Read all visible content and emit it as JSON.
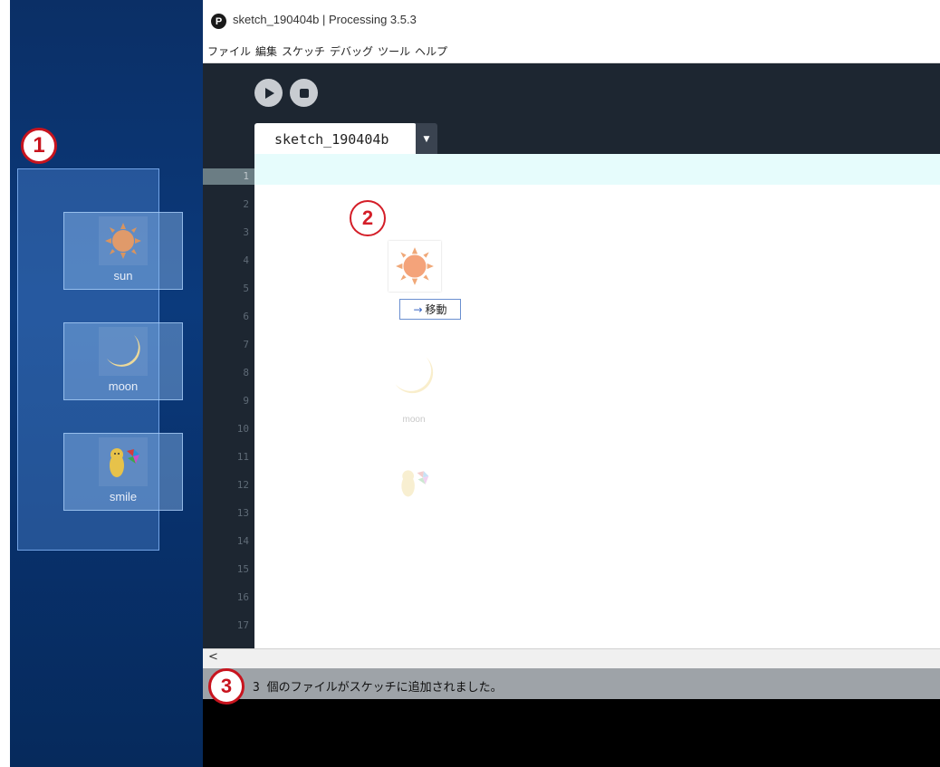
{
  "window": {
    "title": "sketch_190404b | Processing 3.5.3",
    "app_icon_glyph": "P"
  },
  "menu": [
    "ファイル",
    "編集",
    "スケッチ",
    "デバッグ",
    "ツール",
    "ヘルプ"
  ],
  "toolbar": {
    "run_icon": "play-icon",
    "stop_icon": "stop-icon"
  },
  "tab": {
    "label": "sketch_190404b",
    "arrow": "▼"
  },
  "editor": {
    "line_numbers": [
      "1",
      "2",
      "3",
      "4",
      "5",
      "6",
      "7",
      "8",
      "9",
      "10",
      "11",
      "12",
      "13",
      "14",
      "15",
      "16",
      "17"
    ]
  },
  "desktop": {
    "files": [
      {
        "label": "sun",
        "icon": "sun-icon"
      },
      {
        "label": "moon",
        "icon": "moon-icon"
      },
      {
        "label": "smile",
        "icon": "smile-icon"
      }
    ]
  },
  "drag": {
    "tooltip": "移動",
    "tooltip_arrow": "→",
    "moon_label": "moon"
  },
  "scroll": {
    "left_arrow": "<"
  },
  "status": {
    "message": "3 個のファイルがスケッチに追加されました。"
  },
  "callouts": [
    "1",
    "2",
    "3"
  ],
  "colors": {
    "editor_bg": "#1d2631",
    "current_line": "#e6fcfc",
    "status_bg": "#9ea3a8",
    "callout_red": "#c8141e",
    "desktop_blue": "#0b3a7c"
  }
}
